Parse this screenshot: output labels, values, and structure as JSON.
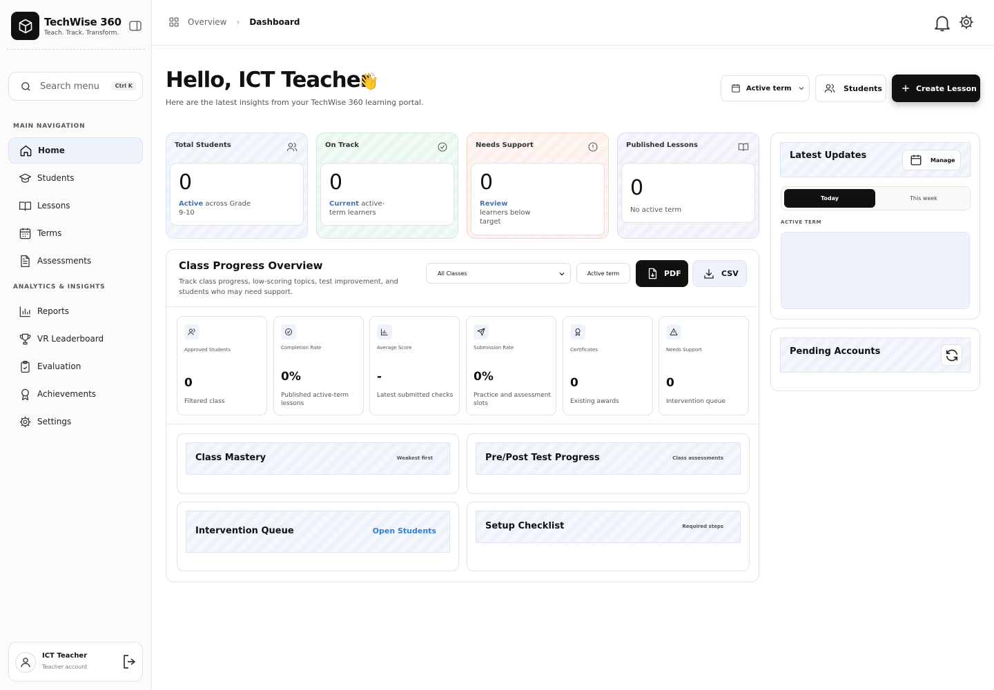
{
  "brand": {
    "name": "TechWise 360",
    "tagline": "Teach. Track. Transform."
  },
  "search": {
    "label": "Search menu",
    "shortcut": "Ctrl K"
  },
  "nav": {
    "main_heading": "MAIN NAVIGATION",
    "main_items": [
      {
        "label": "Home",
        "icon": "home-icon",
        "active": true
      },
      {
        "label": "Students",
        "icon": "graduation-cap-icon"
      },
      {
        "label": "Lessons",
        "icon": "book-icon"
      },
      {
        "label": "Terms",
        "icon": "calendar-icon"
      },
      {
        "label": "Assessments",
        "icon": "document-icon"
      }
    ],
    "analytics_heading": "ANALYTICS & INSIGHTS",
    "analytics_items": [
      {
        "label": "Reports",
        "icon": "bar-chart-icon"
      },
      {
        "label": "VR Leaderboard",
        "icon": "trophy-icon"
      },
      {
        "label": "Evaluation",
        "icon": "clipboard-check-icon"
      },
      {
        "label": "Achievements",
        "icon": "award-icon"
      },
      {
        "label": "Settings",
        "icon": "gear-icon"
      }
    ]
  },
  "user": {
    "name": "ICT Teacher",
    "role": "Teacher account"
  },
  "breadcrumb": {
    "parent": "Overview",
    "current": "Dashboard"
  },
  "header": {
    "greeting": "Hello, ICT Teacher",
    "wave": "👋",
    "subtitle": "Here are the latest insights from your TechWise 360 learning portal.",
    "term_button": "Active term",
    "students_button": "Students",
    "create_button": "Create Lesson"
  },
  "stats": [
    {
      "title": "Total Students",
      "value": "0",
      "highlight": "Active",
      "desc": " across Grade 9-10",
      "accent": "#eef3fb",
      "border": "#dde5f2"
    },
    {
      "title": "On Track",
      "value": "0",
      "highlight": "Current",
      "desc": " active-term learners",
      "accent": "#eaf7ef",
      "border": "#cfead9"
    },
    {
      "title": "Needs Support",
      "value": "0",
      "highlight": "Review",
      "desc": "learners below target",
      "accent": "#fdf0ea",
      "border": "#f5d7c8"
    },
    {
      "title": "Published Lessons",
      "value": "0",
      "highlight": "",
      "desc": "No active term",
      "accent": "#f3effb",
      "border": "#e1d9f3"
    }
  ],
  "progress": {
    "title": "Class Progress Overview",
    "subtitle": "Track class progress, low-scoring topics, test improvement, and students who may need support.",
    "class_select": "All Classes",
    "term_button": "Active term",
    "pdf_button": "PDF",
    "csv_button": "CSV",
    "metrics": [
      {
        "label": "Approved Students",
        "value": "0",
        "desc": "Filtered class",
        "icon": "users-icon"
      },
      {
        "label": "Completion Rate",
        "value": "0%",
        "desc": "Published active-term lessons",
        "icon": "check-circle-icon"
      },
      {
        "label": "Average Score",
        "value": "-",
        "desc": "Latest submitted checks",
        "icon": "bar-chart-icon"
      },
      {
        "label": "Submission Rate",
        "value": "0%",
        "desc": "Practice and assessment slots",
        "icon": "send-icon"
      },
      {
        "label": "Certificates",
        "value": "0",
        "desc": "Existing awards",
        "icon": "award-icon"
      },
      {
        "label": "Needs Support",
        "value": "0",
        "desc": "Intervention queue",
        "icon": "alert-triangle-icon"
      }
    ],
    "cards": {
      "mastery": {
        "title": "Class Mastery",
        "tag": "Weakest first"
      },
      "prepost": {
        "title": "Pre/Post Test Progress",
        "tag": "Class assessments"
      },
      "intervention": {
        "title": "Intervention Queue",
        "link": "Open Students"
      },
      "setup": {
        "title": "Setup Checklist",
        "tag": "Required steps"
      }
    }
  },
  "updates": {
    "title": "Latest Updates",
    "manage_button": "Manage",
    "tab_today": "Today",
    "tab_week": "This week",
    "term_label": "ACTIVE TERM"
  },
  "pending": {
    "title": "Pending Accounts"
  },
  "colors": {
    "primary": "#111111",
    "accent_blue": "#4573b7",
    "link_blue": "#2d7fd8",
    "soft_blue": "#eef3fb"
  }
}
